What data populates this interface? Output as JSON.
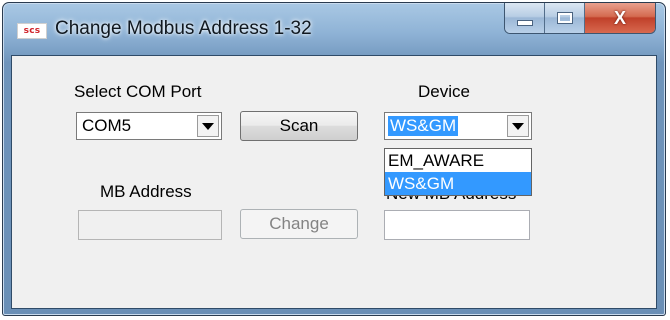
{
  "window": {
    "title": "Change Modbus Address 1-32",
    "icon_text": "scs",
    "close_glyph": "X"
  },
  "com_port": {
    "label": "Select COM Port",
    "selected": "COM5"
  },
  "scan_button": {
    "label": "Scan"
  },
  "device": {
    "label": "Device",
    "selected": "WS&GM",
    "options": [
      "EM_AWARE",
      "WS&GM"
    ],
    "highlighted_option": "WS&GM"
  },
  "mb_address": {
    "label": "MB Address",
    "value": ""
  },
  "change_button": {
    "label": "Change",
    "enabled": false
  },
  "new_mb_address": {
    "label": "New MB Address",
    "value": ""
  },
  "colors": {
    "selection": "#3399ff",
    "close_button": "#c0402a",
    "icon_text": "#d0232b"
  }
}
